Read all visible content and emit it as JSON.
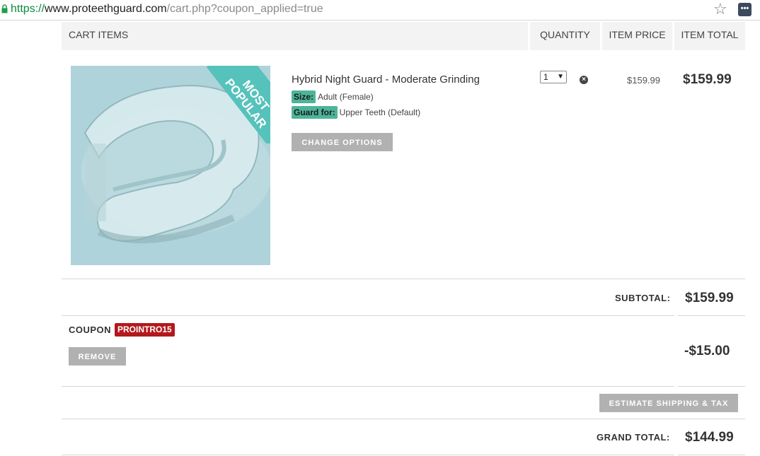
{
  "browser": {
    "url_scheme": "https://",
    "url_host": "www.proteethguard.com",
    "url_path": "/cart.php?coupon_applied=true",
    "ext_label": "•••"
  },
  "cart": {
    "headers": {
      "items": "CART ITEMS",
      "quantity": "QUANTITY",
      "item_price": "ITEM PRICE",
      "item_total": "ITEM TOTAL"
    },
    "item": {
      "badge": "MOST POPULAR",
      "name": "Hybrid Night Guard - Moderate Grinding",
      "options": [
        {
          "label": "Size:",
          "value": "Adult (Female)"
        },
        {
          "label": "Guard for:",
          "value": "Upper Teeth (Default)"
        }
      ],
      "change_options_label": "CHANGE OPTIONS",
      "quantity": "1",
      "price": "$159.99",
      "total": "$159.99"
    },
    "subtotal_label": "SUBTOTAL:",
    "subtotal": "$159.99",
    "coupon_label": "COUPON",
    "coupon_code": "PROINTRO15",
    "remove_label": "REMOVE",
    "discount": "-$15.00",
    "estimate_label": "ESTIMATE SHIPPING & TAX",
    "grand_total_label": "GRAND TOTAL:",
    "grand_total": "$144.99"
  },
  "colors": {
    "accent_green": "#4db49a",
    "coupon_red": "#b3181c",
    "button_gray": "#b1b1b1",
    "ribbon_teal": "#56c2bc"
  }
}
